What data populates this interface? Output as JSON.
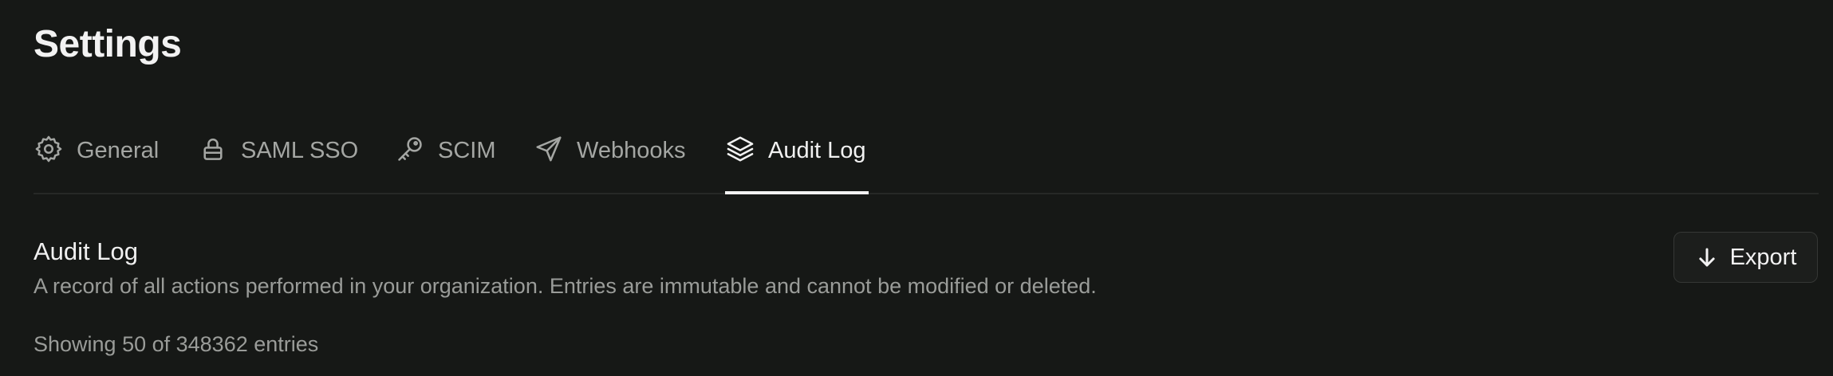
{
  "header": {
    "title": "Settings"
  },
  "tabs": [
    {
      "label": "General",
      "icon": "gear-icon",
      "active": false
    },
    {
      "label": "SAML SSO",
      "icon": "lock-icon",
      "active": false
    },
    {
      "label": "SCIM",
      "icon": "key-icon",
      "active": false
    },
    {
      "label": "Webhooks",
      "icon": "send-icon",
      "active": false
    },
    {
      "label": "Audit Log",
      "icon": "layers-icon",
      "active": true
    }
  ],
  "section": {
    "title": "Audit Log",
    "description": "A record of all actions performed in your organization. Entries are immutable and cannot be modified or deleted.",
    "entries_text": "Showing 50 of 348362 entries"
  },
  "actions": {
    "export_label": "Export",
    "export_icon": "arrow-down-icon"
  },
  "colors": {
    "background": "#161816",
    "text_primary": "#f2f2f2",
    "text_muted": "#9a9c99",
    "tab_inactive": "#a4a6a3",
    "border": "#262826"
  }
}
